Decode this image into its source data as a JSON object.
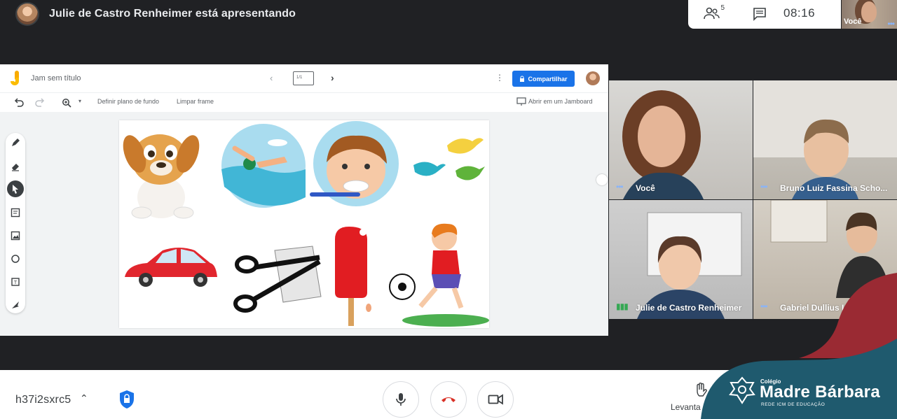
{
  "presenter": {
    "text": "Julie de Castro Renheimer está apresentando"
  },
  "top_card": {
    "people_count": "5",
    "time": "08:16"
  },
  "self_view": {
    "label": "Você"
  },
  "jamboard": {
    "title": "Jam sem título",
    "frame_indicator": "1/1",
    "share_label": "Compartilhar",
    "toolbar": {
      "set_background": "Definir plano de fundo",
      "clear_frame": "Limpar frame",
      "open_in_jamboard": "Abrir em um Jamboard"
    },
    "canvas_items": [
      "dog",
      "swimming",
      "brushing-teeth",
      "birds",
      "car",
      "scissors-paper",
      "popsicle",
      "soccer-boy"
    ]
  },
  "participants": [
    {
      "name": "Você"
    },
    {
      "name": "Bruno Luiz Fassina Scho..."
    },
    {
      "name": "Julie de Castro Renheimer"
    },
    {
      "name": "Gabriel Dullius I"
    }
  ],
  "bottom_bar": {
    "meeting_code": "h37i2sxrc5",
    "raise_hand_label": "Levanta"
  },
  "branding": {
    "small": "Colégio",
    "name": "Madre Bárbara",
    "sub": "REDE ICM DE EDUCAÇÃO",
    "colors": {
      "teal": "#1f5a6e",
      "maroon": "#9a2a33"
    }
  }
}
